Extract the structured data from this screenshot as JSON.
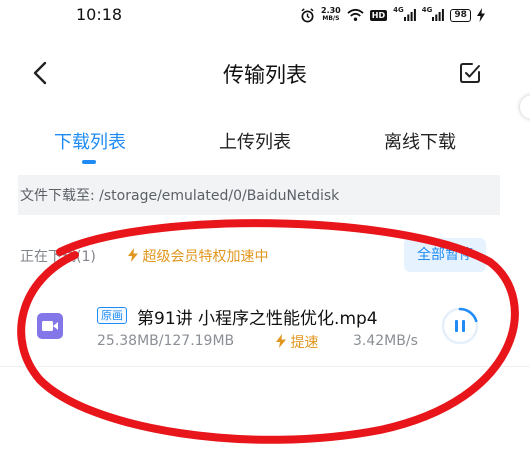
{
  "status_bar": {
    "time": "10:18",
    "net_speed_value": "2.30",
    "net_speed_unit": "MB/S",
    "hd_label": "HD",
    "signal1_label": "4G",
    "signal2_label": "4G",
    "battery": "98"
  },
  "header": {
    "title": "传输列表",
    "back_icon": "chevron-left-icon",
    "select_icon": "checkbox-edit-icon"
  },
  "tabs": [
    {
      "label": "下载列表",
      "active": true
    },
    {
      "label": "上传列表",
      "active": false
    },
    {
      "label": "离线下载",
      "active": false
    }
  ],
  "path": {
    "text": "文件下载至: /storage/emulated/0/BaiduNetdisk"
  },
  "section": {
    "label": "正在下载(1)",
    "boost_text": "超级会员特权加速中",
    "pause_all_label": "全部暂停"
  },
  "downloads": [
    {
      "badge": "原画",
      "name": "第91讲  小程序之性能优化.mp4",
      "size": "25.38MB/127.19MB",
      "speedup_label": "提速",
      "rate": "3.42MB/s",
      "progress": 0.2,
      "icon": "video-file-icon"
    }
  ],
  "colors": {
    "accent": "#1f8cf5",
    "boost": "#e1961d",
    "annotation": "#e8161b",
    "file_icon": "#8276e8"
  }
}
